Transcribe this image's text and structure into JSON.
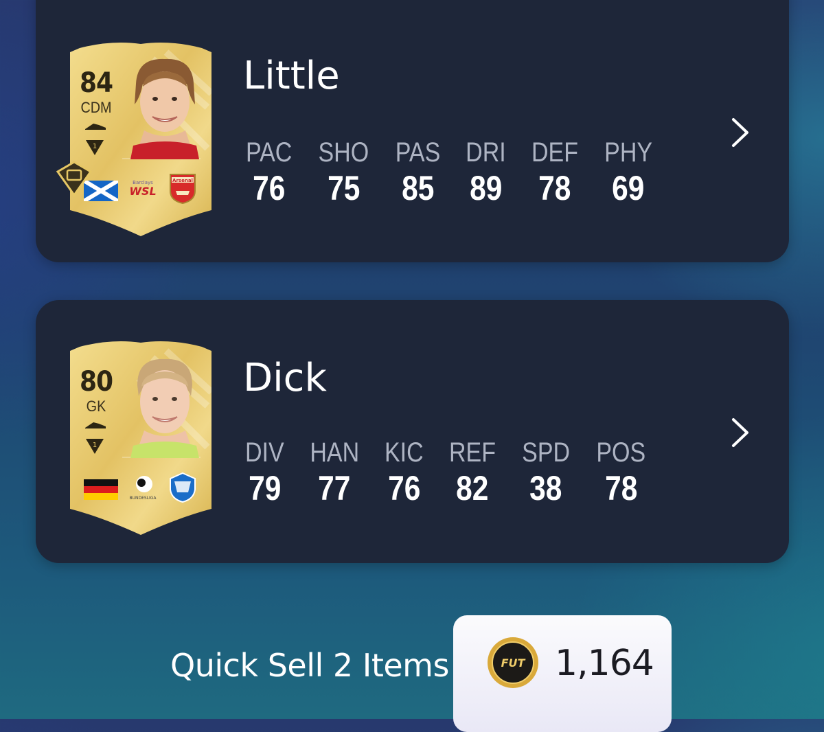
{
  "players": [
    {
      "name": "Little",
      "rating": "84",
      "position": "CDM",
      "nation": "Scotland",
      "club": "Arsenal",
      "stats": [
        {
          "label": "PAC",
          "value": "76"
        },
        {
          "label": "SHO",
          "value": "75"
        },
        {
          "label": "PAS",
          "value": "85"
        },
        {
          "label": "DRI",
          "value": "89"
        },
        {
          "label": "DEF",
          "value": "78"
        },
        {
          "label": "PHY",
          "value": "69"
        }
      ]
    },
    {
      "name": "Dick",
      "rating": "80",
      "position": "GK",
      "nation": "Germany",
      "club": "Hoffenheim",
      "stats": [
        {
          "label": "DIV",
          "value": "79"
        },
        {
          "label": "HAN",
          "value": "77"
        },
        {
          "label": "KIC",
          "value": "76"
        },
        {
          "label": "REF",
          "value": "82"
        },
        {
          "label": "SPD",
          "value": "38"
        },
        {
          "label": "POS",
          "value": "78"
        }
      ]
    }
  ],
  "quick_sell": {
    "label": "Quick Sell 2 Items",
    "coins": "1,164",
    "coin_icon_text": "FUT"
  },
  "colors": {
    "panel": "#1e2639",
    "card_gold": "#e6c765",
    "stat_label": "#aeb4c3",
    "value": "#ffffff"
  }
}
